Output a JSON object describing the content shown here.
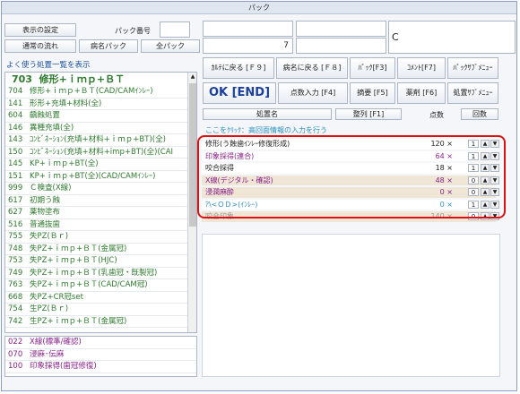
{
  "window_title": "パック",
  "top_left": {
    "display_settings": "表示の設定",
    "pack_number_label": "パック番号",
    "regular_flow": "通常の流れ",
    "disease_pack": "病名パック",
    "all_pack": "全パック"
  },
  "summary": {
    "count_value": "7",
    "code_letter": "C"
  },
  "favorites": {
    "header": "よく使う処置一覧を表示",
    "selected_code": "703",
    "selected_name": "修形+ｉｍｐ+ＢＴ",
    "items": [
      {
        "code": "704",
        "name": "修形+ｉｍｐ+ＢＴ(CAD/CAMｲﾝﾚｰ)",
        "color": "#2c7a2c"
      },
      {
        "code": "141",
        "name": "形形+充填+材料(全)",
        "color": "#2c7a2c"
      },
      {
        "code": "604",
        "name": "齲蝕処置",
        "color": "#2c7a2c"
      },
      {
        "code": "146",
        "name": "異種充填(全)",
        "color": "#2c7a2c"
      },
      {
        "code": "143",
        "name": "ｺﾝﾋﾞﾈｰｼｮﾝ(充填+材料+ｉｍｐ+BT)(全)",
        "color": "#2c7a2c"
      },
      {
        "code": "150",
        "name": "ｺﾝﾋﾞﾈｰｼｮﾝ(充填+材料+imp+BT)(全)(CAI",
        "color": "#2c7a2c"
      },
      {
        "code": "145",
        "name": "KP+ｉｍｐ+BT(全)",
        "color": "#2c7a2c"
      },
      {
        "code": "151",
        "name": "KP+ｉｍｐ+BT(全)(CAD/CAMｲﾝﾚｰ)",
        "color": "#2c7a2c"
      },
      {
        "code": "999",
        "name": "Ｃ検査(X線)",
        "color": "#2c7a2c"
      },
      {
        "code": "617",
        "name": "初期う蝕",
        "color": "#2c7a2c"
      },
      {
        "code": "627",
        "name": "薬物塗布",
        "color": "#2c7a2c"
      },
      {
        "code": "516",
        "name": "普通抜歯",
        "color": "#2c7a2c"
      },
      {
        "code": "755",
        "name": "失PZ(Ｂｒ)",
        "color": "#2c7a2c"
      },
      {
        "code": "748",
        "name": "失PZ+ｉｍｐ+ＢＴ(金属冠)",
        "color": "#2c7a2c"
      },
      {
        "code": "753",
        "name": "失PZ+ｉｍｐ+ＢＴ(HJC)",
        "color": "#2c7a2c"
      },
      {
        "code": "749",
        "name": "失PZ+ｉｍｐ+ＢＴ(乳歯冠・既製冠)",
        "color": "#2c7a2c"
      },
      {
        "code": "763",
        "name": "失PZ+ｉｍｐ+ＢＴ(CAD/CAM冠)",
        "color": "#2c7a2c"
      },
      {
        "code": "668",
        "name": "失PZ+CR冠set",
        "color": "#2c7a2c"
      },
      {
        "code": "754",
        "name": "生PZ(Ｂｒ)",
        "color": "#2c7a2c"
      },
      {
        "code": "742",
        "name": "生PZ+ｉｍｐ+ＢＴ(金属冠)",
        "color": "#2c7a2c"
      }
    ],
    "bottom_items": [
      {
        "code": "022",
        "name": "X線(標準/確認)",
        "color": "#8a1f8a"
      },
      {
        "code": "070",
        "name": "浸麻･伝麻",
        "color": "#8a1f8a"
      },
      {
        "code": "100",
        "name": "印象採得(歯冠修復)",
        "color": "#8a1f8a"
      }
    ]
  },
  "right_buttons": {
    "row1": [
      "ｶﾙﾃに戻る [Ｆ９]",
      "病名に戻る [Ｆ８]",
      "ﾊﾟｯｸ[F3]",
      "ｺﾒﾝﾄ[F7]",
      "ﾊﾟｯｸｻﾌﾞﾒﾆｭｰ"
    ],
    "ok": "OK [END]",
    "row2": [
      "点数入力 [F4]",
      "摘要 [F5]",
      "薬剤 [F6]",
      "処置ｻﾌﾞﾒﾆｭｰ"
    ]
  },
  "grid": {
    "headers": {
      "name": "処置名",
      "sort": "整列 [F1]",
      "points": "点数",
      "count": "回数"
    },
    "info_row": "ここをｸﾘｯｸ：高回面情報の入力を行う",
    "rows": [
      {
        "name": "修形(う蝕歯ｲﾝﾚｰ修復形成)",
        "points": "120",
        "count": "1",
        "color": "#222222",
        "bg": "#ffffff"
      },
      {
        "name": "印象採得(連合)",
        "points": "64",
        "count": "1",
        "color": "#8a1f8a",
        "bg": "#ffffff"
      },
      {
        "name": "咬合採得",
        "points": "18",
        "count": "1",
        "color": "#222222",
        "bg": "#ffffff"
      },
      {
        "name": "X線(デジタル・確認)",
        "points": "48",
        "count": "0",
        "color": "#8a1f8a",
        "bg": "#efe6d6"
      },
      {
        "name": "浸潤麻酔",
        "points": "0",
        "count": "0",
        "color": "#8a1f8a",
        "bg": "#efe6d6"
      },
      {
        "name": "ｱ\\<ＯＤ>(ｲﾝﾚｰ)",
        "points": "0",
        "count": "1",
        "color": "#2a8fbf",
        "bg": "#ffffff"
      },
      {
        "name": "咬合印象",
        "points": "140",
        "count": "0",
        "color": "#999999",
        "bg": "#efe6d6"
      }
    ],
    "multiplier": "×",
    "up_arrow": "▲",
    "down_arrow": "▼"
  },
  "highlight_color": "#dd1111"
}
